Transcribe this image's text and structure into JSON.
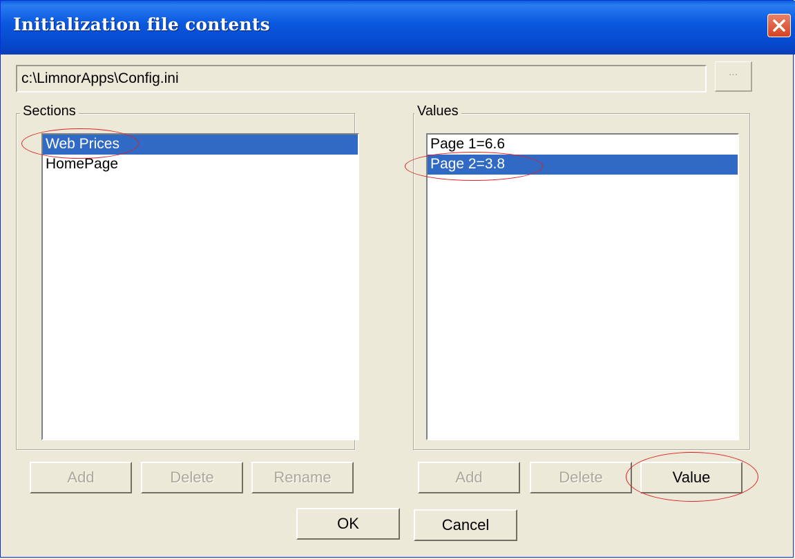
{
  "window": {
    "title": "Initialization file contents",
    "close_icon": "close-icon"
  },
  "file": {
    "path": "c:\\LimnorApps\\Config.ini",
    "browse_label": "..."
  },
  "sections": {
    "label": "Sections",
    "items": [
      "Web Prices",
      "HomePage"
    ],
    "selected": "Web Prices",
    "buttons": {
      "add": "Add",
      "delete": "Delete",
      "rename": "Rename"
    }
  },
  "values": {
    "label": "Values",
    "items": [
      "Page 1=6.6",
      "Page 2=3.8"
    ],
    "selected": "Page 2=3.8",
    "buttons": {
      "add": "Add",
      "delete": "Delete",
      "value": "Value"
    }
  },
  "dialog_buttons": {
    "ok": "OK",
    "cancel": "Cancel"
  },
  "colors": {
    "titlebar": "#0a5fdb",
    "selection": "#316ac5",
    "annotation": "#e02020",
    "background": "#ece9d8"
  }
}
